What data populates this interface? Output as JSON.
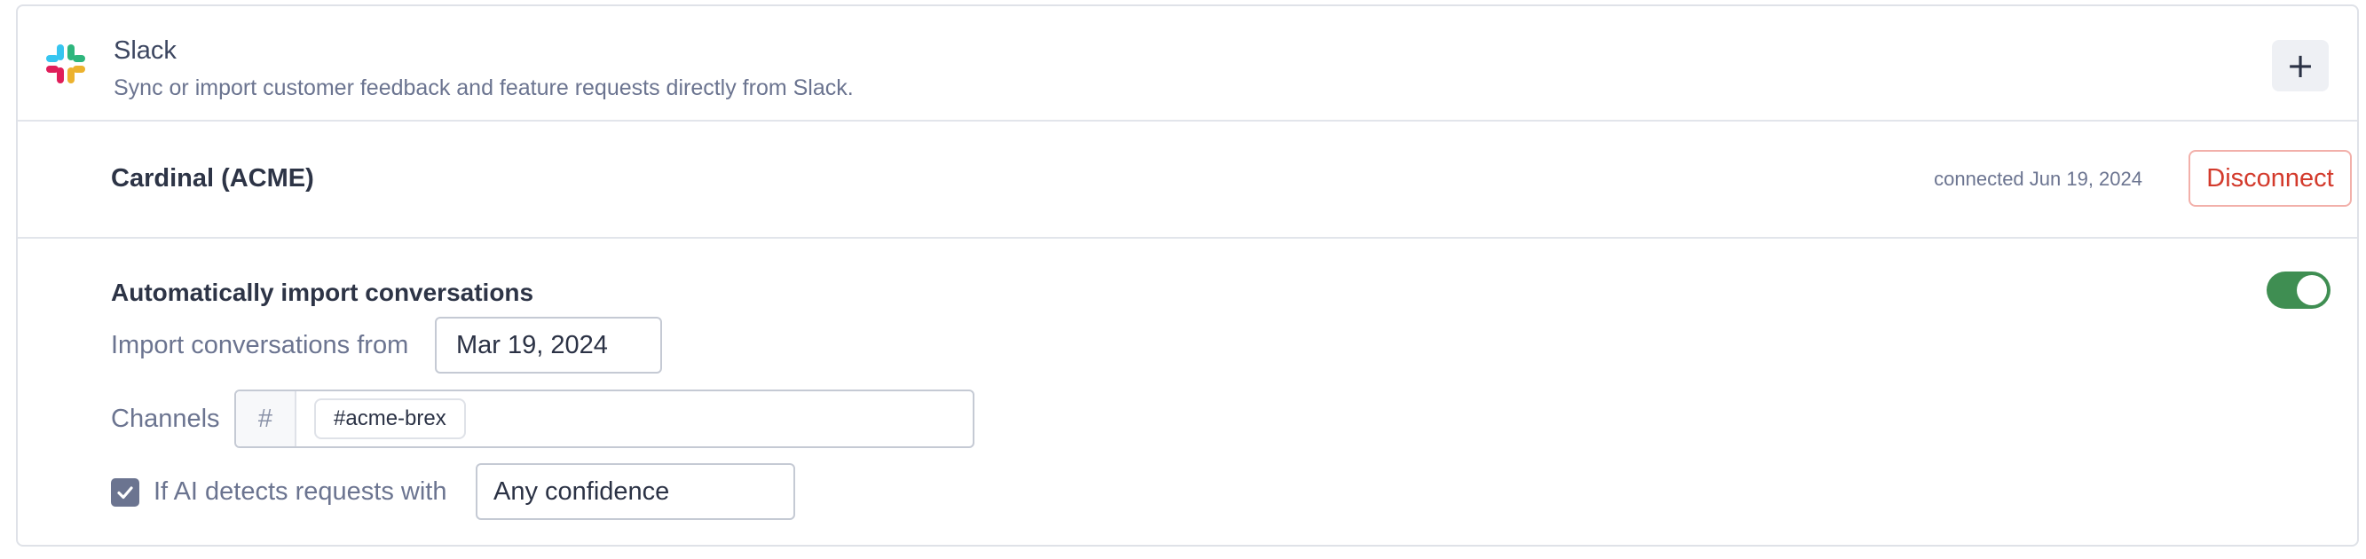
{
  "integration": {
    "name": "Slack",
    "description": "Sync or import customer feedback and feature requests directly from Slack.",
    "logo_icon": "slack-logo",
    "add_icon": "plus-icon"
  },
  "workspace": {
    "name": "Cardinal (ACME)",
    "connected_text": "connected Jun 19, 2024",
    "disconnect_label": "Disconnect"
  },
  "settings": {
    "auto_import_label": "Automatically import conversations",
    "auto_import_enabled": true,
    "toggle_color": "#3f8e52",
    "import_from_label": "Import conversations from",
    "import_from_value": "Mar 19, 2024",
    "channels_label": "Channels",
    "channels_prefix": "#",
    "channels": [
      "#acme-brex"
    ],
    "ai_checkbox_checked": true,
    "ai_detect_label": "If AI detects requests with",
    "confidence_value": "Any confidence"
  },
  "colors": {
    "disconnect": "#d33a2c",
    "muted_text": "#6b7490",
    "slack_blue": "#36c5f0",
    "slack_green": "#2eb67d",
    "slack_yellow": "#ecb22e",
    "slack_red": "#e01e5a"
  }
}
